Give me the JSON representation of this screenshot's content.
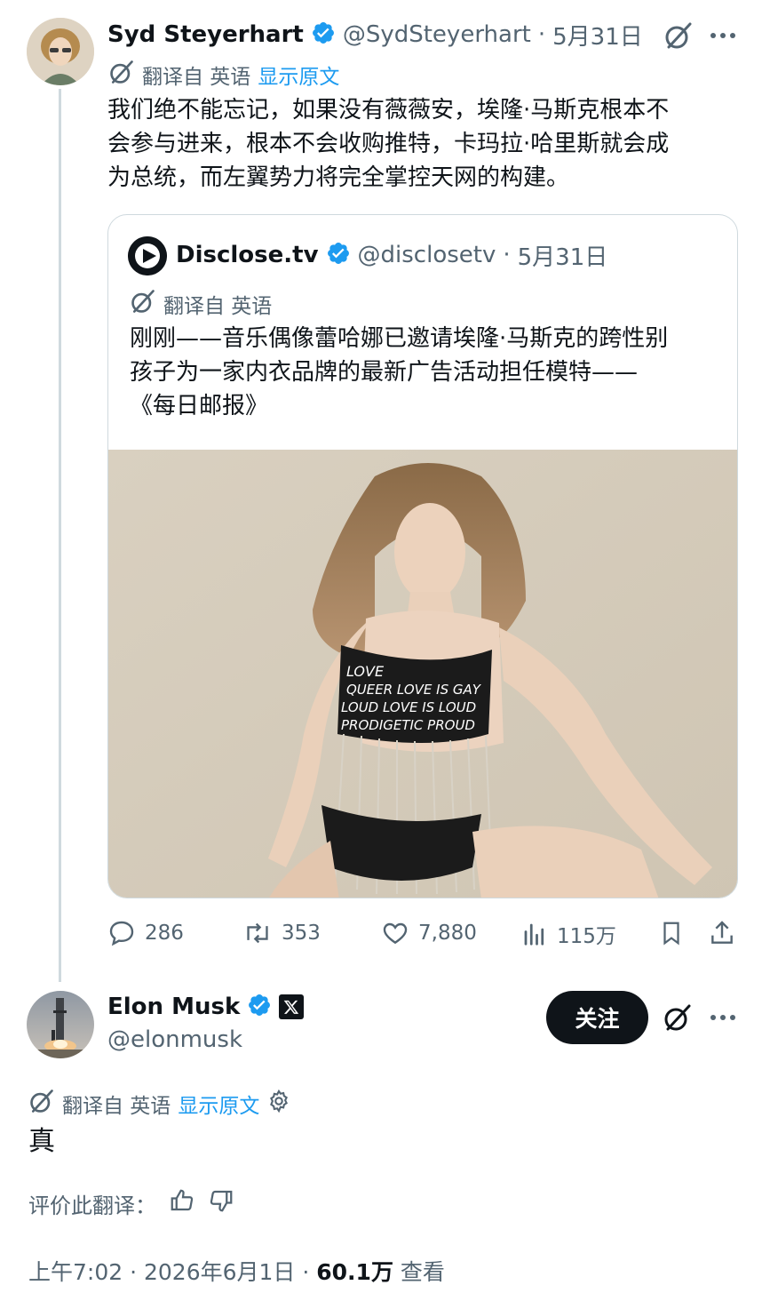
{
  "reply_to": {
    "author_name": "Syd Steyerhart",
    "handle": "@SydSteyerhart",
    "date": "5月31日",
    "translate_label": "翻译自 英语",
    "show_original": "显示原文",
    "text_lines": [
      "我们绝不能忘记，如果没有薇薇安，埃隆·马斯克根本不",
      "会参与进来，根本不会收购推特，卡玛拉·哈里斯就会成",
      "为总统，而左翼势力将完全掌控天网的构建。"
    ],
    "quote": {
      "author_name": "Disclose.tv",
      "handle": "@disclosetv",
      "date": "5月31日",
      "translate_label": "翻译自 英语",
      "text_lines": [
        "刚刚——音乐偶像蕾哈娜已邀请埃隆·马斯克的跨性别",
        "孩子为一家内衣品牌的最新广告活动担任模特——",
        "《每日邮报》"
      ],
      "image_top_text": [
        "LOVE",
        "QUEER LOVE IS GAY",
        "LOUD LOVE IS LOUD",
        "PRODIGETIC PROUD"
      ]
    },
    "stats": {
      "replies": "286",
      "reposts": "353",
      "likes": "7,880",
      "views": "115万"
    }
  },
  "main_post": {
    "author_name": "Elon Musk",
    "handle": "@elonmusk",
    "follow_label": "关注",
    "translate_label": "翻译自 英语",
    "show_original": "显示原文",
    "text": "真",
    "rate_label": "评价此翻译：",
    "footer_time": "上午7:02 · 2026年6月1日 · ",
    "footer_views": "60.1万",
    "footer_views_suffix": " 查看"
  },
  "colors": {
    "verified": "#1d9bf0",
    "link": "#1d9bf0",
    "muted": "#536471",
    "line": "#cfd9de"
  },
  "icons": [
    "grok-icon",
    "more-icon",
    "verified-icon",
    "reply-icon",
    "repost-icon",
    "like-icon",
    "views-icon",
    "bookmark-icon",
    "share-icon",
    "gear-icon",
    "thumbs-up-icon",
    "thumbs-down-icon",
    "x-logo-icon"
  ]
}
